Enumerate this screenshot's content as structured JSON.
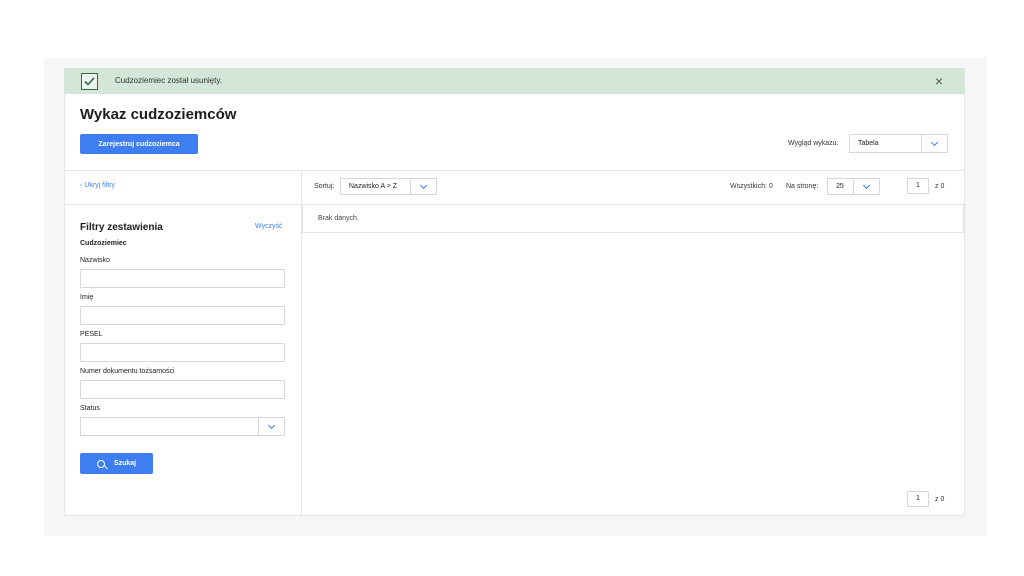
{
  "alert": {
    "message": "Cudzoziemiec został usunięty.",
    "close": "×"
  },
  "page": {
    "title": "Wykaz cudzoziemców"
  },
  "toolbar": {
    "register_label": "Zarejestruj cudzoziemca",
    "view_label": "Wygląd wykazu:",
    "view_value": "Tabela"
  },
  "list_bar": {
    "hide_filters": "‹ Ukryj filtry",
    "sort_label": "Sortuj:",
    "sort_value": "Nazwisko A > Z",
    "total": "Wszystkich: 0",
    "per_page_label": "Na stronę:",
    "per_page_value": "25",
    "page_current": "1",
    "page_of": "z 0"
  },
  "results": {
    "empty": "Brak danych."
  },
  "filters": {
    "title": "Filtry zestawienia",
    "clear": "Wyczyść",
    "section": "Cudzoziemiec",
    "fields": [
      {
        "label": "Nazwisko",
        "value": ""
      },
      {
        "label": "Imię",
        "value": ""
      },
      {
        "label": "PESEL",
        "value": ""
      },
      {
        "label": "Numer dokumentu tożsamości",
        "value": ""
      }
    ],
    "status_label": "Status",
    "status_value": "",
    "search_label": "Szukaj"
  },
  "pagination_bottom": {
    "page_current": "1",
    "page_of": "z 0"
  },
  "colors": {
    "accent": "#3f7ef0",
    "alert_bg": "#d3e6d8",
    "alert_icon": "#2e6b3e"
  }
}
